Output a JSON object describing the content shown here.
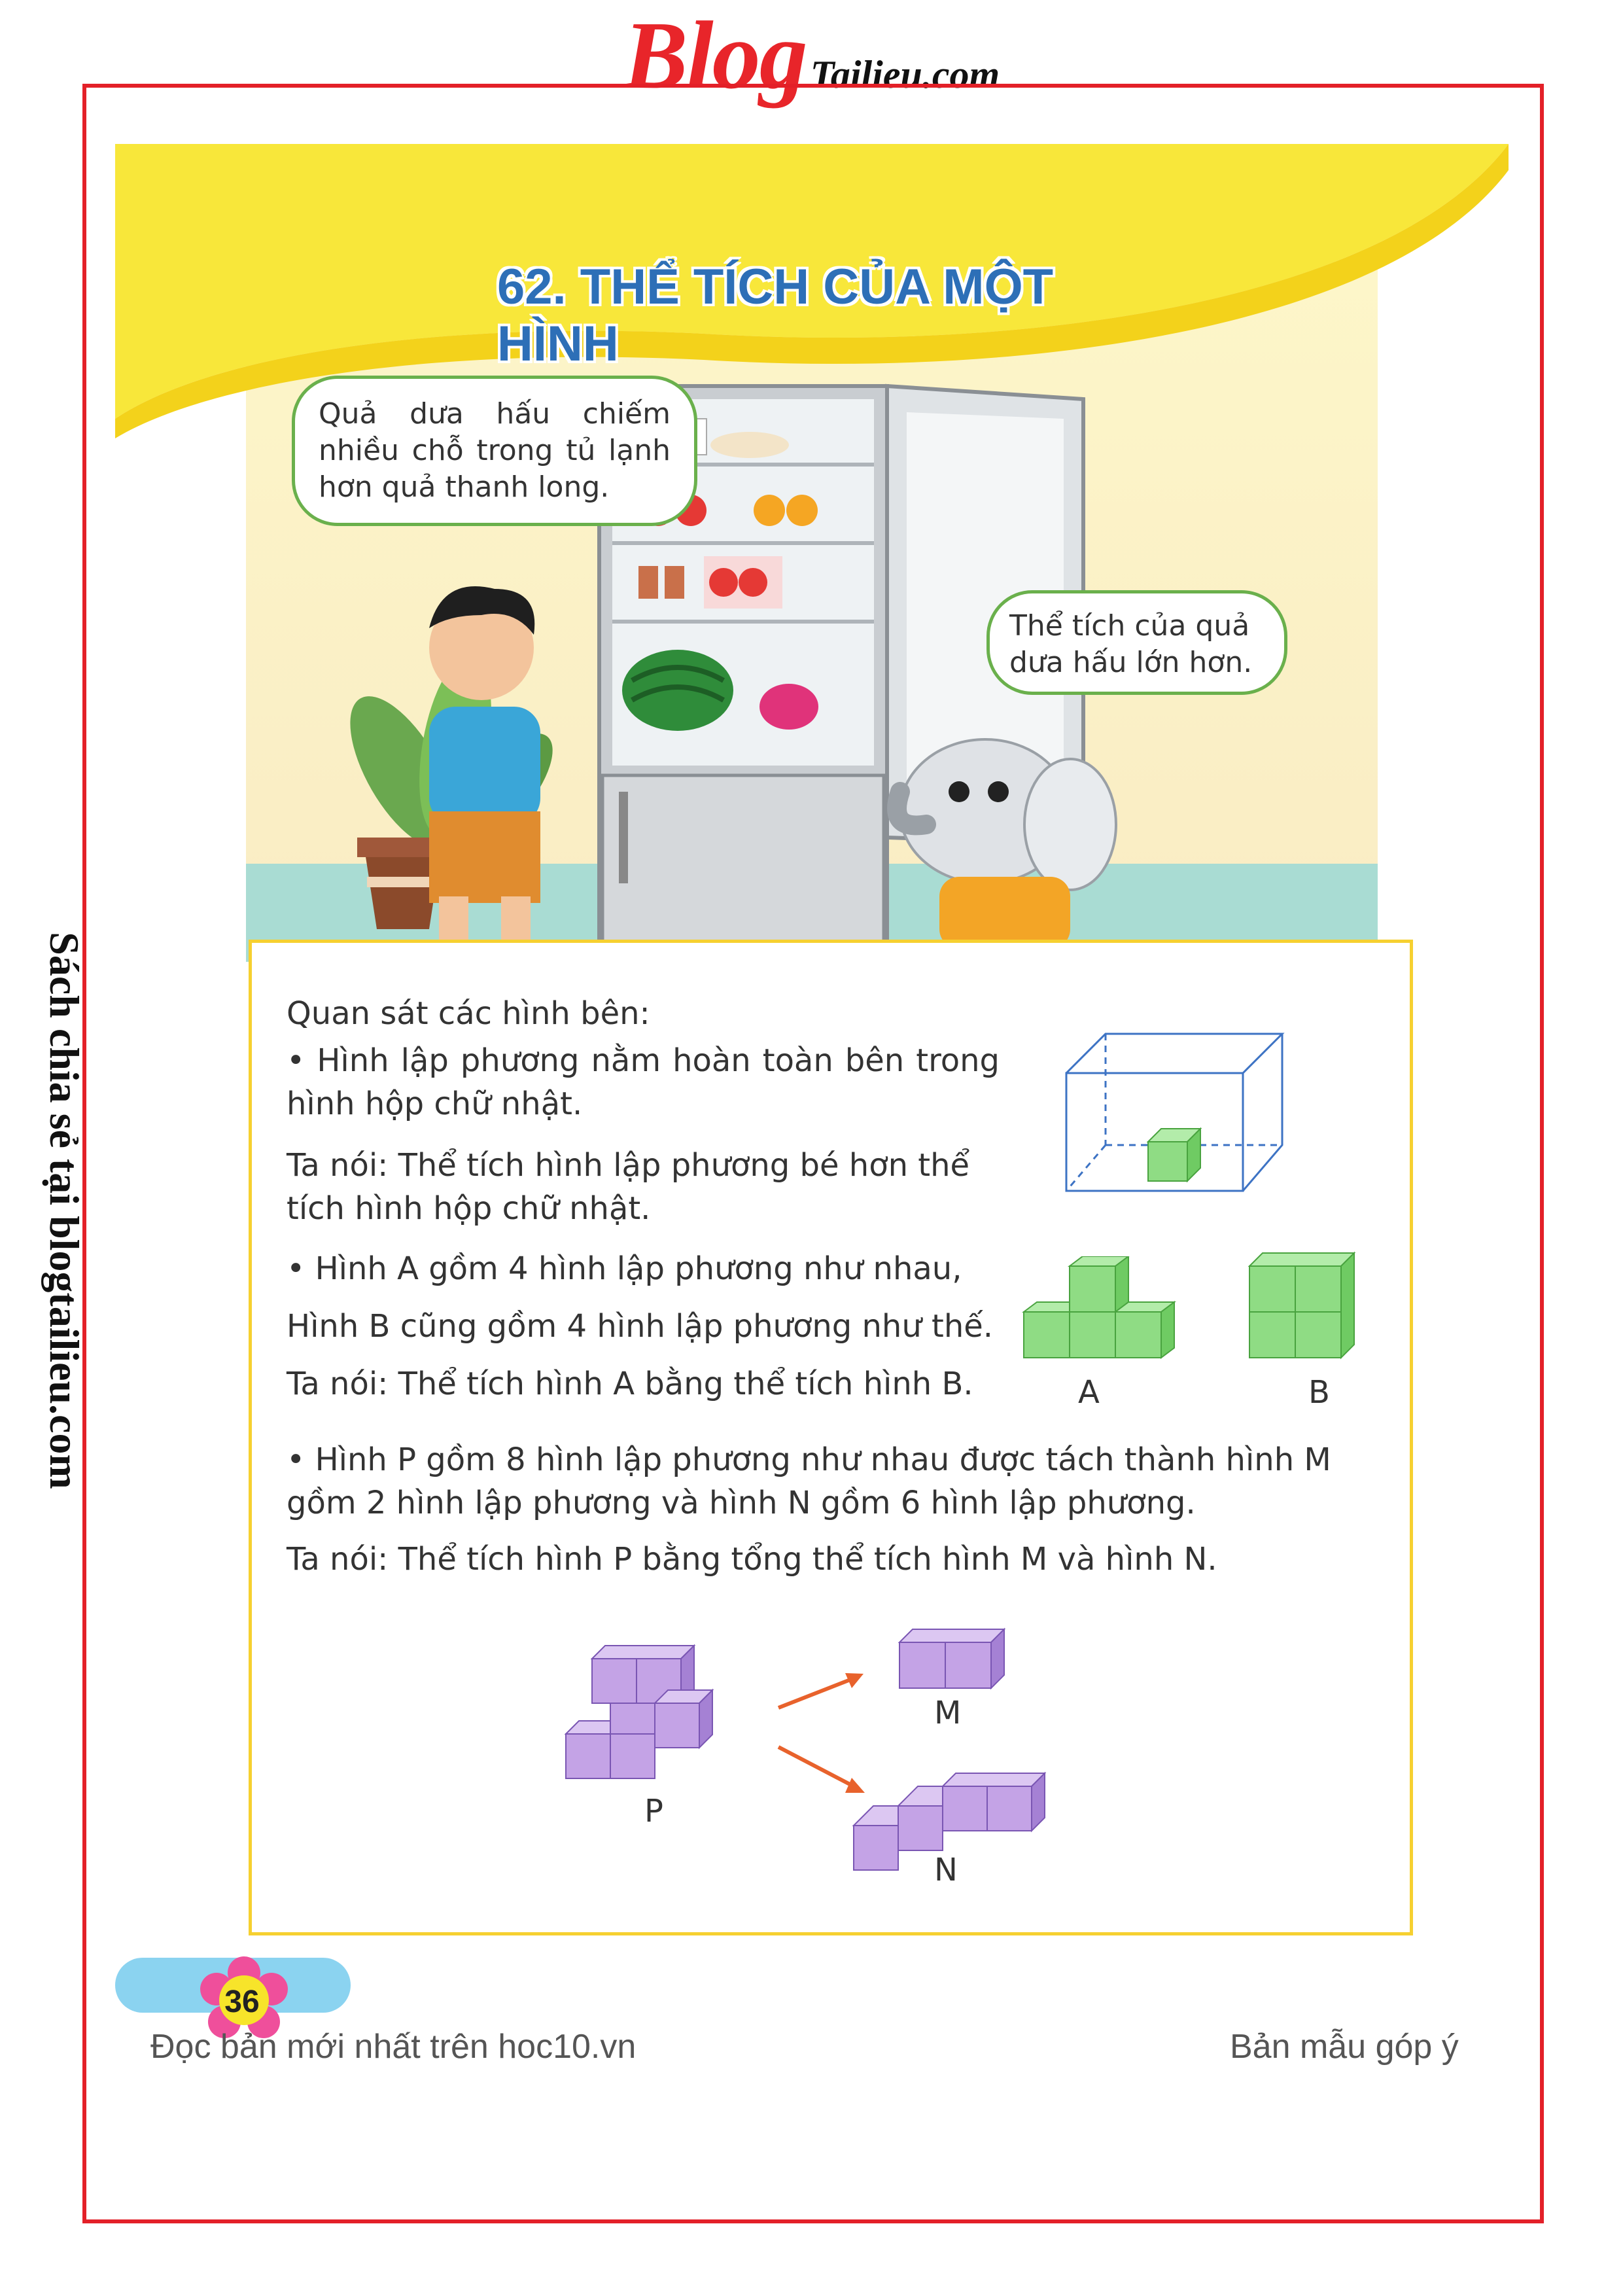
{
  "header": {
    "logo_big": "Blog",
    "logo_small": "Tailieu.com"
  },
  "side_note": "Sách chia sẻ tại blogtailieu.com",
  "lesson": {
    "title": "62. THỂ TÍCH CỦA MỘT HÌNH"
  },
  "illustration": {
    "boy_speech": "Quả dưa hấu chiếm nhiều chỗ trong tủ lạnh hơn quả thanh long.",
    "elephant_speech": "Thể tích của quả dưa hấu lớn hơn."
  },
  "content": {
    "intro": "Quan sát các hình bên:",
    "cube_in_box_1": "• Hình lập phương nằm hoàn toàn bên trong hình hộp chữ nhật.",
    "cube_in_box_2": "Ta nói: Thể tích hình lập phương bé hơn thể tích hình hộp chữ nhật.",
    "ab_1": "• Hình A gồm 4 hình lập phương như nhau,",
    "ab_2": "Hình B cũng gồm 4 hình lập phương như thế.",
    "ab_3": "Ta nói: Thể tích hình A bằng thể tích hình B.",
    "pmn_1": "• Hình P gồm 8 hình lập phương như nhau được tách thành hình M gồm 2 hình lập phương và hình N gồm 6 hình lập phương.",
    "pmn_2": "Ta nói: Thể tích hình P bằng tổng thể tích hình M và hình N.",
    "label_a": "A",
    "label_b": "B",
    "label_p": "P",
    "label_m": "M",
    "label_n": "N"
  },
  "footer": {
    "page_number": "36",
    "left_text": "Đọc bản mới nhất trên hoc10.vn",
    "right_text": "Bản mẫu góp ý"
  },
  "colors": {
    "border_red": "#e32028",
    "title_blue": "#2d6fb7",
    "banner_yellow": "#f8e73a",
    "cube_green": "#8fdc84",
    "cube_purple": "#c4a3e6",
    "arrow_orange": "#e8622c"
  }
}
